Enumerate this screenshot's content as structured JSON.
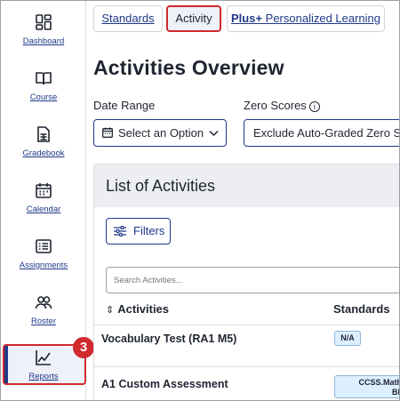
{
  "sidebar": {
    "items": [
      {
        "label": "Dashboard",
        "icon": "dashboard-icon"
      },
      {
        "label": "Course",
        "icon": "book-icon"
      },
      {
        "label": "Gradebook",
        "icon": "gradebook-icon"
      },
      {
        "label": "Calendar",
        "icon": "calendar-icon"
      },
      {
        "label": "Assignments",
        "icon": "assignments-icon"
      },
      {
        "label": "Roster",
        "icon": "roster-icon"
      },
      {
        "label": "Reports",
        "icon": "chart-line-icon"
      }
    ],
    "step_badge": "3"
  },
  "tabs": {
    "standards": "Standards",
    "activity": "Activity",
    "plus_brand": "Plus+",
    "plus_rest": " Personalized Learning"
  },
  "page": {
    "title": "Activities Overview"
  },
  "filters": {
    "date_range_label": "Date Range",
    "date_range_value": "Select an Option",
    "zero_scores_label": "Zero Scores",
    "zero_scores_value": "Exclude Auto-Graded Zero Scores"
  },
  "list": {
    "title": "List of Activities",
    "filters_button": "Filters",
    "search_placeholder": "Search Activities...",
    "col_activities": "Activities",
    "col_standards": "Standards",
    "rows": [
      {
        "name": "Vocabulary Test (RA1 M5)",
        "standard": "N/A"
      },
      {
        "name": "A1 Custom Assessment",
        "standard_line1": "CCSS.Math.C",
        "standard_line2": "BF.A"
      }
    ]
  },
  "colors": {
    "accent": "#1f3a8a",
    "highlight": "#d0292e",
    "pill_bg": "#dcefff"
  }
}
